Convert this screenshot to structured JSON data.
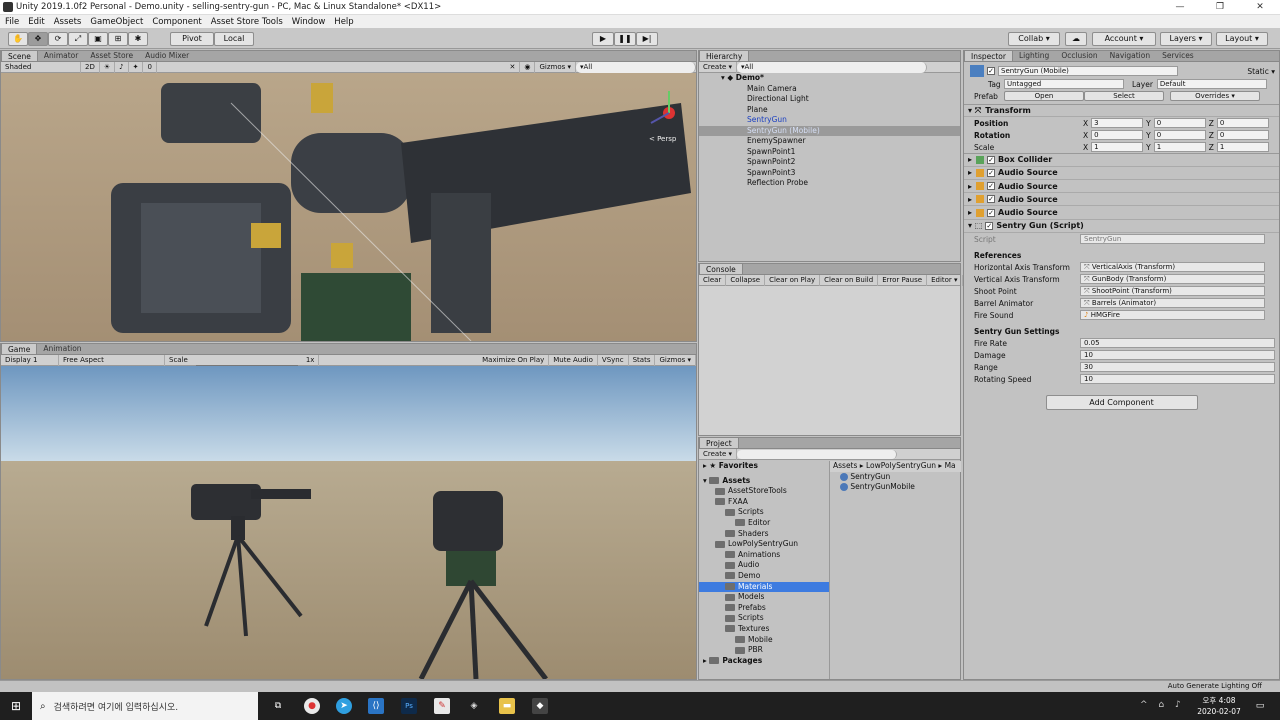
{
  "window": {
    "title": "Unity 2019.1.0f2 Personal - Demo.unity - selling-sentry-gun - PC, Mac & Linux Standalone* <DX11>"
  },
  "menu": [
    "File",
    "Edit",
    "Assets",
    "GameObject",
    "Component",
    "Asset Store Tools",
    "Window",
    "Help"
  ],
  "toolbar": {
    "pivot": "Pivot",
    "local": "Local",
    "collab": "Collab ▾",
    "account": "Account ▾",
    "layers": "Layers ▾",
    "layout": "Layout ▾"
  },
  "scene": {
    "tabs": [
      "Scene",
      "Animator",
      "Asset Store",
      "Audio Mixer"
    ],
    "shading": "Shaded",
    "mode2d": "2D",
    "gizmos": "Gizmos ▾",
    "search": "▾All",
    "persp": "< Persp",
    "counter": "0"
  },
  "game": {
    "tabs": [
      "Game",
      "Animation"
    ],
    "display": "Display 1",
    "aspect": "Free Aspect",
    "scale_label": "Scale",
    "scale_value": "1x",
    "buttons": [
      "Maximize On Play",
      "Mute Audio",
      "VSync",
      "Stats",
      "Gizmos ▾"
    ]
  },
  "hierarchy": {
    "tab": "Hierarchy",
    "create": "Create ▾",
    "search": "▾All",
    "scene": "Demo*",
    "items": [
      {
        "label": "Main Camera",
        "style": ""
      },
      {
        "label": "Directional Light",
        "style": ""
      },
      {
        "label": "Plane",
        "style": ""
      },
      {
        "label": "SentryGun",
        "style": "blue"
      },
      {
        "label": "SentryGun (Mobile)",
        "style": "selg"
      },
      {
        "label": "EnemySpawner",
        "style": ""
      },
      {
        "label": "SpawnPoint1",
        "style": ""
      },
      {
        "label": "SpawnPoint2",
        "style": ""
      },
      {
        "label": "SpawnPoint3",
        "style": ""
      },
      {
        "label": "Reflection Probe",
        "style": ""
      }
    ]
  },
  "console": {
    "tab": "Console",
    "buttons": [
      "Clear",
      "Collapse",
      "Clear on Play",
      "Clear on Build",
      "Error Pause",
      "Editor ▾"
    ]
  },
  "project": {
    "tab": "Project",
    "create": "Create ▾",
    "favorites": "Favorites",
    "assets_root": "Assets",
    "packages": "Packages",
    "breadcrumb": [
      "Assets",
      "LowPolySentryGun",
      "Ma"
    ],
    "tree": [
      {
        "label": "AssetStoreTools",
        "indent": 1
      },
      {
        "label": "FXAA",
        "indent": 1
      },
      {
        "label": "Scripts",
        "indent": 2
      },
      {
        "label": "Editor",
        "indent": 3
      },
      {
        "label": "Shaders",
        "indent": 2
      },
      {
        "label": "LowPolySentryGun",
        "indent": 1
      },
      {
        "label": "Animations",
        "indent": 2
      },
      {
        "label": "Audio",
        "indent": 2
      },
      {
        "label": "Demo",
        "indent": 2
      },
      {
        "label": "Materials",
        "indent": 2,
        "selected": true
      },
      {
        "label": "Models",
        "indent": 2
      },
      {
        "label": "Prefabs",
        "indent": 2
      },
      {
        "label": "Scripts",
        "indent": 2
      },
      {
        "label": "Textures",
        "indent": 2
      },
      {
        "label": "Mobile",
        "indent": 3
      },
      {
        "label": "PBR",
        "indent": 3
      }
    ],
    "files": [
      "SentryGun",
      "SentryGunMobile"
    ]
  },
  "inspector": {
    "tabs": [
      "Inspector",
      "Lighting",
      "Occlusion",
      "Navigation",
      "Services"
    ],
    "object_name": "SentryGun (Mobile)",
    "static": "Static ▾",
    "tag_label": "Tag",
    "tag": "Untagged",
    "layer_label": "Layer",
    "layer": "Default",
    "prefab_label": "Prefab",
    "prefab_open": "Open",
    "prefab_select": "Select",
    "prefab_overrides": "Overrides ▾",
    "transform": {
      "title": "Transform",
      "position": [
        "3",
        "0",
        "0"
      ],
      "rotation": [
        "0",
        "0",
        "0"
      ],
      "scale": [
        "1",
        "1",
        "1"
      ],
      "labels": [
        "Position",
        "Rotation",
        "Scale"
      ]
    },
    "components": [
      "Box Collider",
      "Audio Source",
      "Audio Source",
      "Audio Source",
      "Audio Source"
    ],
    "script": {
      "title": "Sentry Gun (Script)",
      "script_label": "Script",
      "script_value": "SentryGun",
      "references_header": "References",
      "refs": [
        {
          "label": "Horizontal Axis Transform",
          "value": "VerticalAxis (Transform)"
        },
        {
          "label": "Vertical Axis Transform",
          "value": "GunBody (Transform)"
        },
        {
          "label": "Shoot Point",
          "value": "ShootPoint (Transform)"
        },
        {
          "label": "Barrel Animator",
          "value": "Barrels (Animator)"
        },
        {
          "label": "Fire Sound",
          "value": "HMGFire"
        }
      ],
      "settings_header": "Sentry Gun Settings",
      "settings": [
        {
          "label": "Fire Rate",
          "value": "0.05"
        },
        {
          "label": "Damage",
          "value": "10"
        },
        {
          "label": "Range",
          "value": "30"
        },
        {
          "label": "Rotating Speed",
          "value": "10"
        }
      ]
    },
    "add_component": "Add Component"
  },
  "status": {
    "text": "Auto Generate Lighting Off"
  },
  "taskbar": {
    "search": "검색하려면 여기에 입력하십시오.",
    "time": "오후 4:08",
    "date": "2020-02-07"
  }
}
